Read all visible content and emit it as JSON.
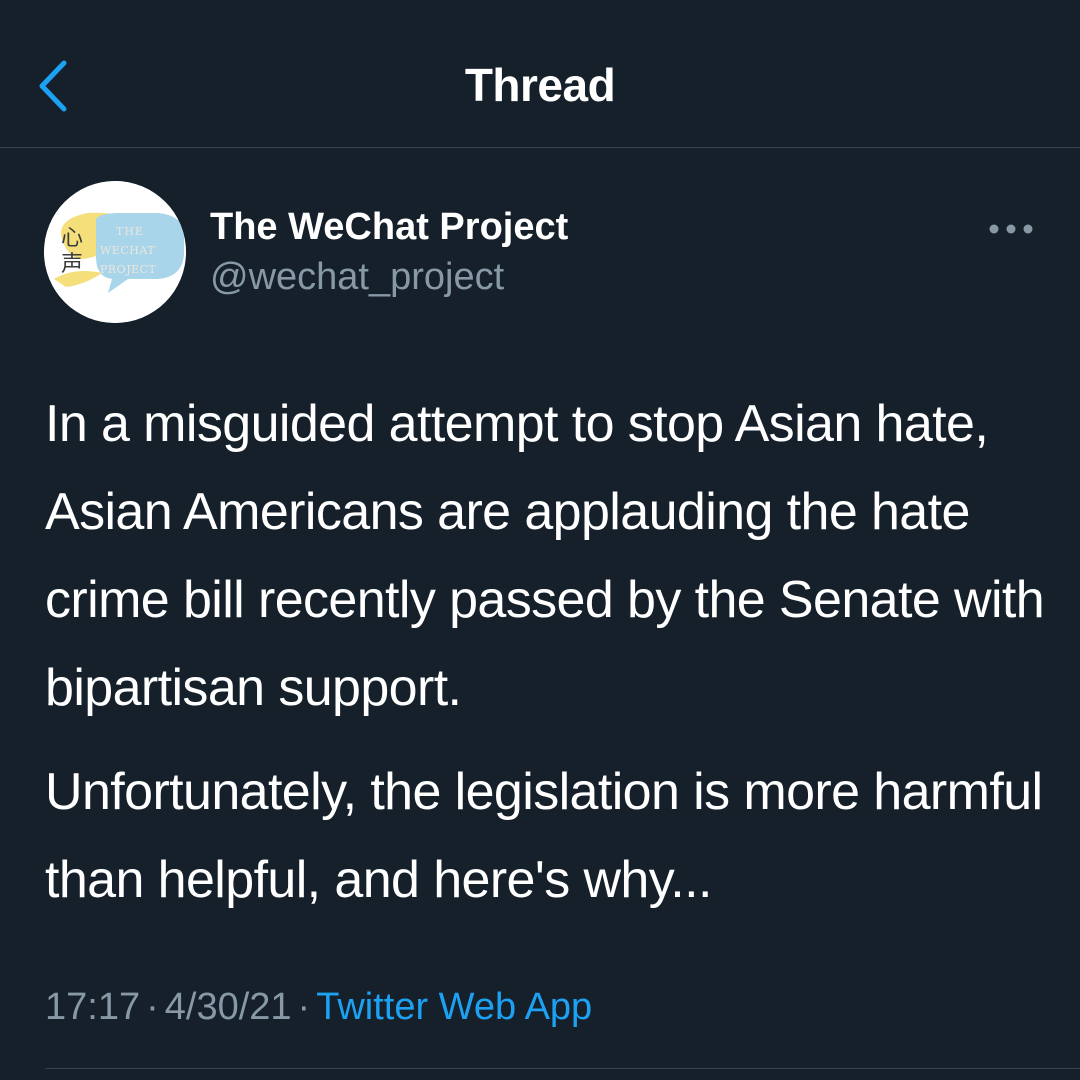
{
  "header": {
    "title": "Thread",
    "back_icon": "chevron-left-icon"
  },
  "tweet": {
    "author": {
      "name": "The WeChat Project",
      "handle": "@wechat_project",
      "avatar": {
        "chinese_text": "心声",
        "logo_lines": [
          "THE",
          "WECHAT",
          "PROJECT"
        ]
      }
    },
    "more_icon": "more-horizontal-icon",
    "paragraphs": [
      "In a misguided attempt to stop Asian hate, Asian Americans are applauding the hate crime bill recently passed by the Senate with bipartisan support.",
      "Unfortunately, the legislation is more harmful than helpful, and here's why..."
    ],
    "time": "17:17",
    "date": "4/30/21",
    "separator": "·",
    "source": "Twitter Web App"
  },
  "colors": {
    "background": "#15202b",
    "text": "#ffffff",
    "secondary_text": "#8899a6",
    "accent": "#1da1f2",
    "divider": "#38444d"
  }
}
